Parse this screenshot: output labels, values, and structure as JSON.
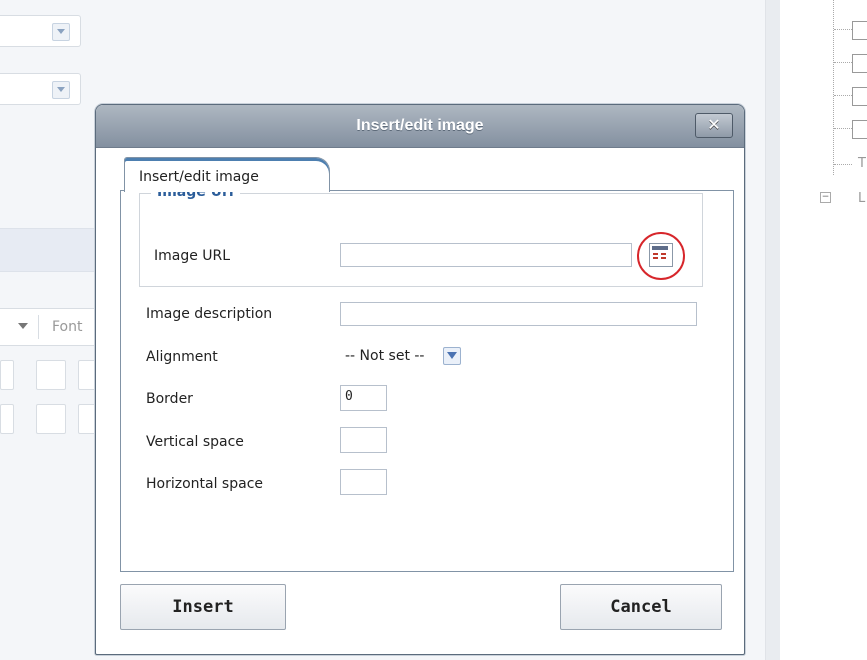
{
  "background": {
    "font_select_label": "Font"
  },
  "dialog": {
    "title": "Insert/edit image",
    "close_label": "✕",
    "tab_label": "Insert/edit image",
    "fieldset_legend": "Image Url",
    "fields": {
      "image_url": {
        "label": "Image URL",
        "value": ""
      },
      "image_description": {
        "label": "Image description",
        "value": ""
      },
      "alignment": {
        "label": "Alignment",
        "selected": "-- Not set --"
      },
      "border": {
        "label": "Border",
        "value": "0"
      },
      "vertical_space": {
        "label": "Vertical space",
        "value": ""
      },
      "horizontal_space": {
        "label": "Horizontal space",
        "value": ""
      }
    },
    "buttons": {
      "insert": "Insert",
      "cancel": "Cancel"
    }
  },
  "tree": {
    "partial_items": [
      "T",
      "L"
    ]
  },
  "colors": {
    "title_bar": "#8c98a6",
    "legend_blue": "#2b5d9a",
    "highlight_circle": "#d7262b"
  },
  "icons": [
    "close-icon",
    "browse-icon",
    "dropdown-arrow-icon"
  ]
}
